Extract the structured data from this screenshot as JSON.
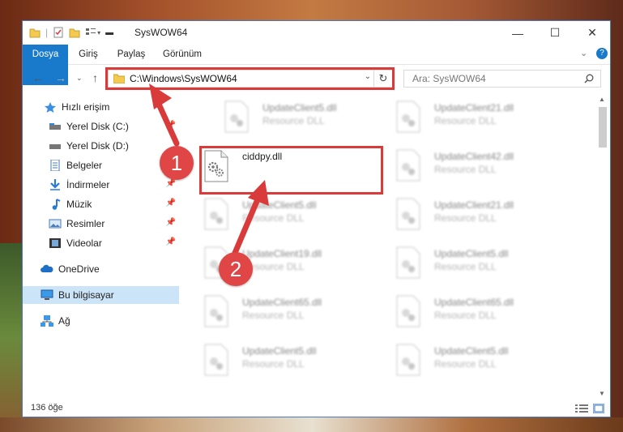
{
  "window": {
    "title": "SysWOW64",
    "minimize_glyph": "—",
    "maximize_glyph": "☐",
    "close_glyph": "✕"
  },
  "ribbon": {
    "tabs": [
      "Dosya",
      "Giriş",
      "Paylaş",
      "Görünüm"
    ],
    "file_tab_color": "#1979ca",
    "help_glyph": "?"
  },
  "nav": {
    "address": "C:\\Windows\\SysWOW64",
    "search_placeholder": "Ara: SysWOW64"
  },
  "sidebar": {
    "items": [
      {
        "label": "Hızlı erişim",
        "icon": "star-icon"
      },
      {
        "label": "Yerel Disk (C:)",
        "icon": "drive-icon"
      },
      {
        "label": "Yerel Disk (D:)",
        "icon": "drive-icon"
      },
      {
        "label": "Belgeler",
        "icon": "documents-icon"
      },
      {
        "label": "İndirmeler",
        "icon": "download-icon"
      },
      {
        "label": "Müzik",
        "icon": "music-icon"
      },
      {
        "label": "Resimler",
        "icon": "pictures-icon"
      },
      {
        "label": "Videolar",
        "icon": "videos-icon"
      },
      {
        "label": "OneDrive",
        "icon": "cloud-icon"
      },
      {
        "label": "Bu bilgisayar",
        "icon": "computer-icon"
      },
      {
        "label": "Ağ",
        "icon": "network-icon"
      }
    ]
  },
  "files": {
    "left": [
      {
        "name": "UpdateClient5.dll",
        "type": "Resource DLL"
      },
      {
        "name": "ciddpy.dll",
        "type": ""
      },
      {
        "name": "UpdateClient5.dll",
        "type": "Resource DLL"
      },
      {
        "name": "UpdateClient19.dll",
        "type": "Resource DLL"
      },
      {
        "name": "UpdateClient65.dll",
        "type": "Resource DLL"
      },
      {
        "name": "UpdateClient5.dll",
        "type": "Resource DLL"
      }
    ],
    "right": [
      {
        "name": "UpdateClient21.dll",
        "type": "Resource DLL"
      },
      {
        "name": "UpdateClient42.dll",
        "type": "Resource DLL"
      },
      {
        "name": "UpdateClient21.dll",
        "type": "Resource DLL"
      },
      {
        "name": "UpdateClient5.dll",
        "type": "Resource DLL"
      },
      {
        "name": "UpdateClient65.dll",
        "type": "Resource DLL"
      },
      {
        "name": "UpdateClient5.dll",
        "type": "Resource DLL"
      }
    ]
  },
  "status": {
    "count": "136 öğe"
  },
  "annotations": {
    "step1": "1",
    "step2": "2",
    "color": "#d93a3a"
  }
}
